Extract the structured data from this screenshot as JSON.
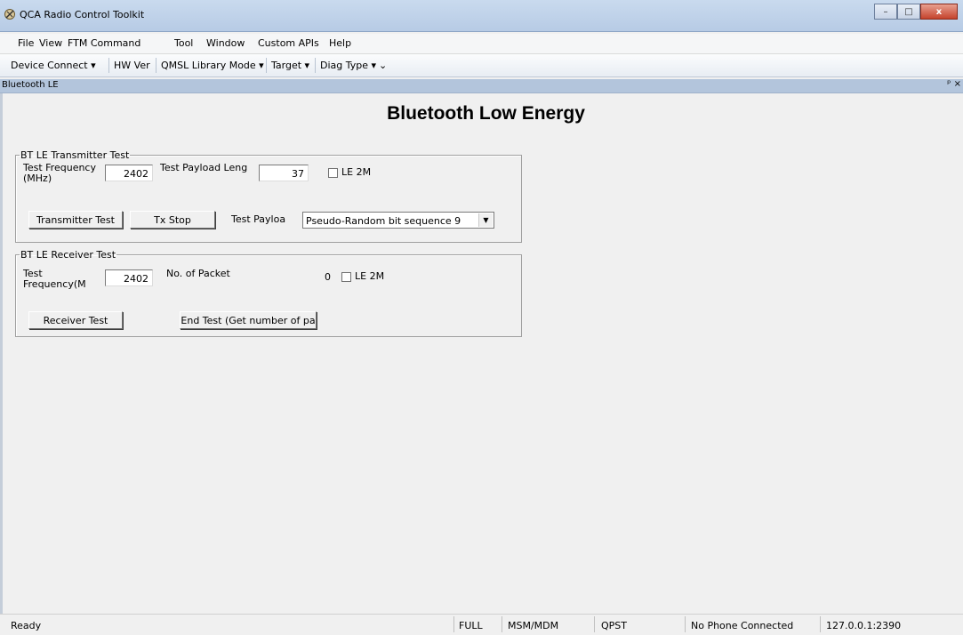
{
  "window": {
    "title": "QCA Radio Control Toolkit",
    "controls": {
      "minimize": "–",
      "maximize": "□",
      "close": "x"
    }
  },
  "menu": [
    "File",
    "View",
    "FTM Command",
    "Tool",
    "Window",
    "Custom APIs",
    "Help"
  ],
  "toolbar": {
    "items": [
      "Device Connect ▾",
      "HW Ver",
      "QMSL Library Mode ▾",
      "Target ▾",
      "Diag Type ▾"
    ],
    "overflow": "⌄"
  },
  "panel": {
    "title": "Bluetooth LE",
    "pin": "ᵖ ×"
  },
  "heading": "Bluetooth Low Energy",
  "tx": {
    "legend": "BT LE Transmitter Test",
    "freq_label_1": "Test Frequency",
    "freq_label_2": "(MHz)",
    "freq_value": "2402",
    "payload_len_label": "Test Payload Leng",
    "payload_len_value": "37",
    "le2m_label": "LE 2M",
    "le2m_checked": false,
    "transmitter_button": "Transmitter Test",
    "tx_stop_button": "Tx Stop",
    "payload_label": "Test Payloa",
    "payload_selected": "Pseudo-Random bit sequence 9"
  },
  "rx": {
    "legend": "BT LE Receiver Test",
    "freq_label_1": "Test",
    "freq_label_2": "Frequency(M",
    "freq_value": "2402",
    "packets_label": "No. of Packet",
    "packets_value": "0",
    "le2m_label": "LE 2M",
    "le2m_checked": false,
    "receiver_button": "Receiver Test",
    "end_button": "End Test (Get number of pa"
  },
  "status": {
    "ready": "Ready",
    "mode": "FULL",
    "chip": "MSM/MDM",
    "qpst": "QPST",
    "phone": "No Phone Connected",
    "address": "127.0.0.1:2390"
  }
}
